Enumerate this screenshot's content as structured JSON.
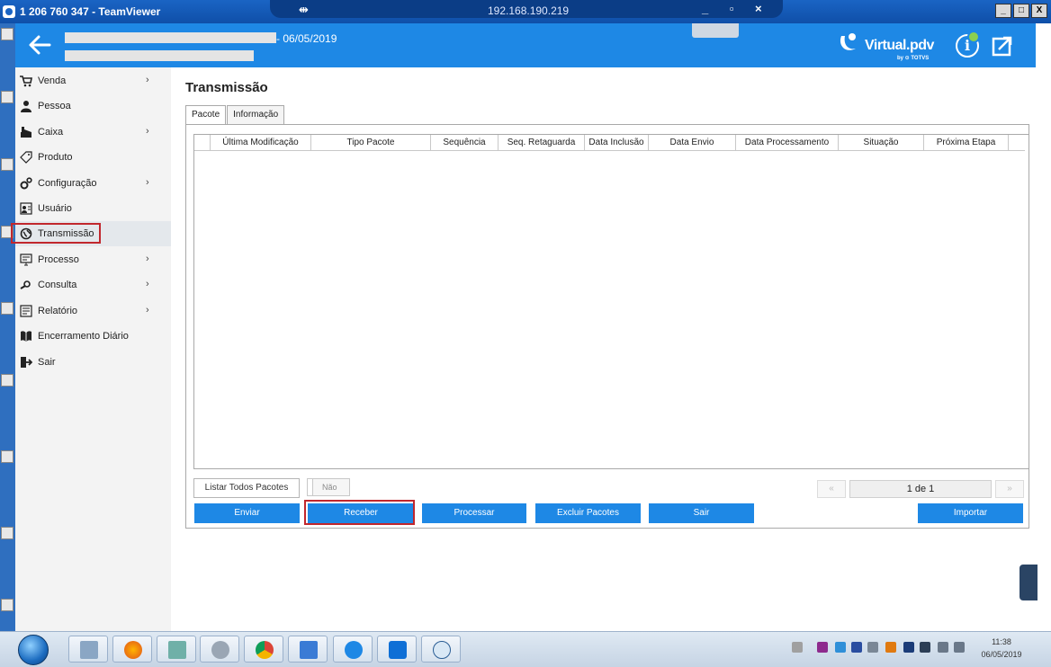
{
  "teamviewer": {
    "title": "1 206 760 347 - TeamViewer",
    "ip": "192.168.190.219",
    "window_controls": "_ ▫ ×",
    "main_controls": [
      "_",
      "□",
      "X"
    ]
  },
  "header": {
    "date_suffix": "- 06/05/2019",
    "brand_name": "Virtual.pdv",
    "brand_by": "by ⊙ TOTVS",
    "colors": {
      "header": "#1e88e5",
      "info_dot": "#8bd04f"
    }
  },
  "sidebar": {
    "items": [
      {
        "label": "Venda",
        "icon": "cart-icon",
        "has_children": true,
        "chevron": "›"
      },
      {
        "label": "Pessoa",
        "icon": "person-icon",
        "has_children": false
      },
      {
        "label": "Caixa",
        "icon": "cash-register-icon",
        "has_children": true,
        "chevron": "›"
      },
      {
        "label": "Produto",
        "icon": "tag-icon",
        "has_children": false
      },
      {
        "label": "Configuração",
        "icon": "gears-icon",
        "has_children": true,
        "chevron": "›"
      },
      {
        "label": "Usuário",
        "icon": "user-card-icon",
        "has_children": false
      },
      {
        "label": "Transmissão",
        "icon": "globe-icon",
        "has_children": false,
        "active": true
      },
      {
        "label": "Processo",
        "icon": "monitor-icon",
        "has_children": true,
        "chevron": "›"
      },
      {
        "label": "Consulta",
        "icon": "magnifier-icon",
        "has_children": true,
        "chevron": "›"
      },
      {
        "label": "Relatório",
        "icon": "report-icon",
        "has_children": true,
        "chevron": "›"
      },
      {
        "label": "Encerramento Diário",
        "icon": "book-icon",
        "has_children": false
      },
      {
        "label": "Sair",
        "icon": "exit-icon",
        "has_children": false
      }
    ]
  },
  "main": {
    "title": "Transmissão",
    "tabs": [
      {
        "label": "Pacote",
        "active": true
      },
      {
        "label": "Informação",
        "active": false
      }
    ],
    "grid": {
      "columns": [
        "",
        "Última Modificação",
        "Tipo Pacote",
        "Sequência",
        "Seq. Retaguarda",
        "Data Inclusão",
        "Data Envio",
        "Data Processamento",
        "Situação",
        "Próxima Etapa",
        ""
      ],
      "rows": []
    },
    "list_all_button": "Listar Todos Pacotes",
    "toggle_label": "Não",
    "pager": {
      "text": "1 de 1",
      "first": "«",
      "last": "»"
    },
    "actions": {
      "enviar": "Enviar",
      "receber": "Receber",
      "processar": "Processar",
      "excluir": "Excluir Pacotes",
      "sair": "Sair",
      "importar": "Importar"
    }
  },
  "taskbar": {
    "time": "11:38",
    "date": "06/05/2019"
  }
}
